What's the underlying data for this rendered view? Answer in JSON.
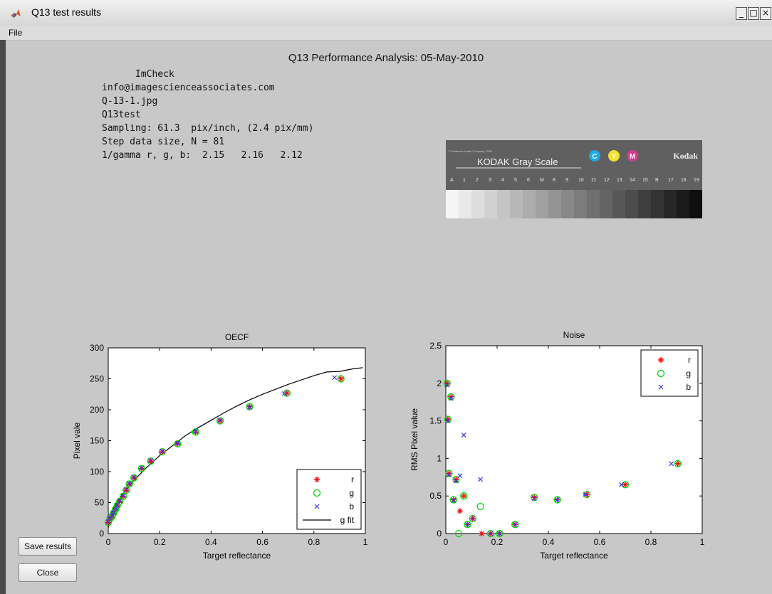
{
  "window": {
    "title": "Q13 test results",
    "minimize": "_",
    "maximize": "□",
    "close": "×"
  },
  "menu": {
    "file": "File"
  },
  "report": {
    "title": "Q13 Performance Analysis: 05-May-2010",
    "lines": [
      "      ImCheck",
      "info@imagescienceassociates.com",
      "Q-13-1.jpg",
      "Q13test",
      "",
      "Sampling: 61.3  pix/inch, (2.4 pix/mm)",
      "Step data size, N = 81",
      "1/gamma r, g, b:  2.15   2.16   2.12"
    ]
  },
  "target_image": {
    "title": "KODAK Gray Scale",
    "brand": "Kodak",
    "patches": [
      "C",
      "Y",
      "M"
    ],
    "scale_labels": [
      "A",
      "1",
      "2",
      "3",
      "4",
      "5",
      "6",
      "M",
      "8",
      "9",
      "10",
      "11",
      "12",
      "13",
      "14",
      "15",
      "B",
      "17",
      "18",
      "19"
    ],
    "small_text": "© Eastman Kodak Company, 2000"
  },
  "buttons": {
    "save": "Save results",
    "close": "Close"
  },
  "chart_data": [
    {
      "type": "scatter",
      "title": "OECF",
      "xlabel": "Target reflectance",
      "ylabel": "Pixel vale",
      "xlim": [
        0,
        1
      ],
      "ylim": [
        0,
        300
      ],
      "xticks": [
        "0",
        "0.2",
        "0.4",
        "0.6",
        "0.8",
        "1"
      ],
      "yticks": [
        "0",
        "50",
        "100",
        "150",
        "200",
        "250",
        "300"
      ],
      "legend": [
        "r",
        "g",
        "b",
        "g fit"
      ],
      "legend_position": "bottom-right",
      "series": [
        {
          "name": "r",
          "color": "#ff0000",
          "marker": "star",
          "x": [
            0.0,
            0.007,
            0.015,
            0.021,
            0.028,
            0.035,
            0.045,
            0.058,
            0.07,
            0.082,
            0.1,
            0.13,
            0.165,
            0.21,
            0.27,
            0.34,
            0.435,
            0.55,
            0.695,
            0.905
          ],
          "y": [
            18,
            24,
            28,
            33,
            39,
            45,
            52,
            60,
            70,
            80,
            90,
            105,
            117,
            132,
            145,
            164,
            182,
            205,
            227,
            250
          ]
        },
        {
          "name": "g",
          "color": "#00dd00",
          "marker": "circle",
          "x": [
            0.0,
            0.007,
            0.015,
            0.021,
            0.028,
            0.035,
            0.045,
            0.058,
            0.07,
            0.082,
            0.1,
            0.13,
            0.165,
            0.21,
            0.27,
            0.34,
            0.435,
            0.55,
            0.695,
            0.905
          ],
          "y": [
            18,
            24,
            28,
            33,
            39,
            45,
            52,
            60,
            70,
            80,
            90,
            105,
            117,
            132,
            145,
            164,
            182,
            205,
            227,
            250
          ]
        },
        {
          "name": "b",
          "color": "#3333ff",
          "marker": "x",
          "x": [
            0.0,
            0.007,
            0.015,
            0.021,
            0.028,
            0.035,
            0.045,
            0.058,
            0.07,
            0.082,
            0.1,
            0.13,
            0.165,
            0.21,
            0.27,
            0.34,
            0.435,
            0.55,
            0.685,
            0.88
          ],
          "y": [
            19,
            25,
            29,
            34,
            40,
            46,
            53,
            61,
            71,
            81,
            91,
            106,
            118,
            133,
            146,
            165,
            183,
            204,
            226,
            252
          ]
        }
      ],
      "fit": {
        "name": "g fit",
        "color": "#000000",
        "x": [
          0.001,
          0.005,
          0.01,
          0.02,
          0.04,
          0.06,
          0.08,
          0.1,
          0.15,
          0.2,
          0.25,
          0.3,
          0.35,
          0.4,
          0.45,
          0.5,
          0.55,
          0.6,
          0.65,
          0.7,
          0.75,
          0.8,
          0.85,
          0.9,
          0.95,
          0.99
        ],
        "y": [
          10,
          23,
          31,
          40,
          54,
          66,
          76,
          86,
          107,
          126,
          142,
          158,
          171,
          183,
          195,
          206,
          216,
          225,
          233,
          241,
          248,
          255,
          261,
          262,
          266,
          268
        ]
      }
    },
    {
      "type": "scatter",
      "title": "Noise",
      "xlabel": "Target reflectance",
      "ylabel": "RMS Pixel value",
      "xlim": [
        0,
        1
      ],
      "ylim": [
        0,
        2.5
      ],
      "xticks": [
        "0",
        "0.2",
        "0.4",
        "0.6",
        "0.8",
        "1"
      ],
      "yticks": [
        "0",
        "0.5",
        "1",
        "1.5",
        "2",
        "2.5"
      ],
      "legend": [
        "r",
        "g",
        "b"
      ],
      "legend_position": "top-right",
      "series": [
        {
          "name": "r",
          "color": "#ff0000",
          "marker": "star",
          "x": [
            0.005,
            0.008,
            0.012,
            0.02,
            0.03,
            0.04,
            0.055,
            0.07,
            0.085,
            0.105,
            0.14,
            0.175,
            0.21,
            0.27,
            0.345,
            0.435,
            0.55,
            0.7,
            0.905
          ],
          "y": [
            2.0,
            1.52,
            0.8,
            1.82,
            0.45,
            0.72,
            0.3,
            0.5,
            0.12,
            0.2,
            0.0,
            0.0,
            0.0,
            0.12,
            0.48,
            0.45,
            0.52,
            0.65,
            0.93
          ]
        },
        {
          "name": "g",
          "color": "#00dd00",
          "marker": "circle",
          "x": [
            0.005,
            0.008,
            0.012,
            0.02,
            0.03,
            0.04,
            0.05,
            0.07,
            0.085,
            0.105,
            0.135,
            0.175,
            0.21,
            0.27,
            0.345,
            0.435,
            0.55,
            0.7,
            0.905
          ],
          "y": [
            2.0,
            1.52,
            0.8,
            1.82,
            0.45,
            0.72,
            0.0,
            0.5,
            0.12,
            0.2,
            0.36,
            0.0,
            0.0,
            0.12,
            0.48,
            0.45,
            0.52,
            0.65,
            0.93
          ]
        },
        {
          "name": "b",
          "color": "#3333ff",
          "marker": "x",
          "x": [
            0.005,
            0.008,
            0.012,
            0.02,
            0.03,
            0.04,
            0.055,
            0.07,
            0.085,
            0.105,
            0.135,
            0.175,
            0.21,
            0.27,
            0.345,
            0.435,
            0.545,
            0.685,
            0.88
          ],
          "y": [
            1.98,
            1.5,
            0.78,
            1.8,
            0.44,
            0.7,
            0.77,
            1.31,
            0.12,
            0.2,
            0.72,
            0.0,
            0.0,
            0.12,
            0.47,
            0.45,
            0.52,
            0.65,
            0.93
          ]
        }
      ]
    }
  ]
}
